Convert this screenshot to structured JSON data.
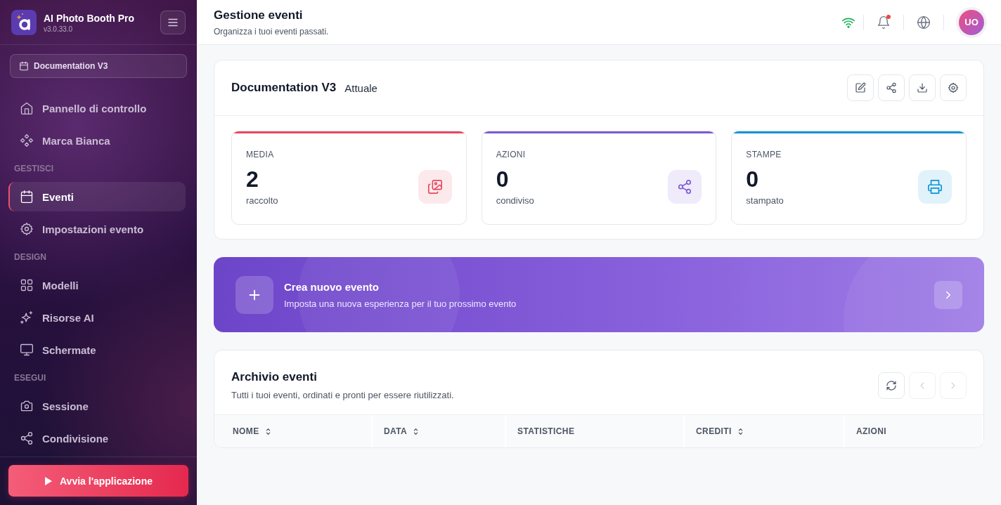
{
  "app": {
    "name": "AI Photo Booth Pro",
    "version": "v3.0.33.0"
  },
  "event_selector": {
    "label": "Documentation V3"
  },
  "sidebar": {
    "items": [
      {
        "kind": "item",
        "label": "Pannello di controllo",
        "selected": false
      },
      {
        "kind": "item",
        "label": "Marca Bianca",
        "selected": false
      },
      {
        "kind": "section",
        "label": "GESTISCI"
      },
      {
        "kind": "item",
        "label": "Eventi",
        "selected": true
      },
      {
        "kind": "item",
        "label": "Impostazioni evento",
        "selected": false
      },
      {
        "kind": "section",
        "label": "DESIGN"
      },
      {
        "kind": "item",
        "label": "Modelli",
        "selected": false
      },
      {
        "kind": "item",
        "label": "Risorse AI",
        "selected": false
      },
      {
        "kind": "item",
        "label": "Schermate",
        "selected": false
      },
      {
        "kind": "section",
        "label": "ESEGUI"
      },
      {
        "kind": "item",
        "label": "Sessione",
        "selected": false
      },
      {
        "kind": "item",
        "label": "Condivisione",
        "selected": false
      }
    ]
  },
  "launch_button": {
    "label": "Avvia l'applicazione"
  },
  "header": {
    "title": "Gestione eventi",
    "subtitle": "Organizza i tuoi eventi passati.",
    "notification_unread": true,
    "avatar": "UO"
  },
  "current_event": {
    "title": "Documentation V3",
    "badge": "Attuale",
    "stats": [
      {
        "label": "MEDIA",
        "value": "2",
        "caption": "raccolto",
        "color": "#e8485f"
      },
      {
        "label": "AZIONI",
        "value": "0",
        "caption": "condiviso",
        "color": "#7c5bd6"
      },
      {
        "label": "STAMPE",
        "value": "0",
        "caption": "stampato",
        "color": "#0b95d6"
      }
    ]
  },
  "banner": {
    "title": "Crea nuovo evento",
    "subtitle": "Imposta una nuova esperienza per il tuo prossimo evento"
  },
  "archive": {
    "title": "Archivio eventi",
    "subtitle": "Tutti i tuoi eventi, ordinati e pronti per essere riutilizzati.",
    "prev_disabled": true,
    "next_disabled": true,
    "table": {
      "columns": [
        {
          "label": "NOME",
          "sortable": true
        },
        {
          "label": "DATA",
          "sortable": true
        },
        {
          "label": "STATISTICHE",
          "sortable": false
        },
        {
          "label": "CREDITI",
          "sortable": true
        },
        {
          "label": "AZIONI",
          "sortable": false
        }
      ]
    }
  }
}
